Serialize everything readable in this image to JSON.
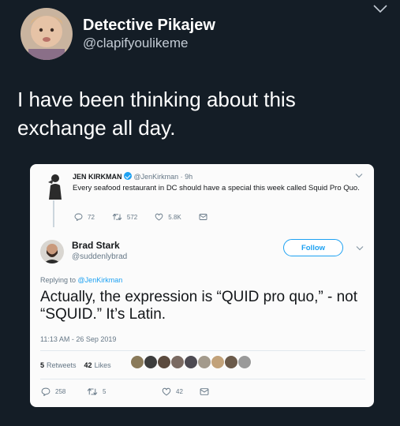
{
  "post": {
    "display_name": "Detective Pikajew",
    "handle": "@clapifyoulikeme",
    "text": "I have been thinking about this exchange all day."
  },
  "quoted_tweet": {
    "name": "JEN KIRKMAN",
    "handle": "@JenKirkman · 9h",
    "text": "Every seafood restaurant in DC should have a special this week called Squid Pro Quo.",
    "replies": "72",
    "retweets": "572",
    "likes": "5.8K"
  },
  "reply_tweet": {
    "name": "Brad Stark",
    "handle": "@suddenlybrad",
    "follow_label": "Follow",
    "replying_to_label": "Replying to",
    "replying_to_handle": "@JenKirkman",
    "text": "Actually, the expression is “QUID pro quo,” - not “SQUID.” It’s Latin.",
    "timestamp": "11:13 AM - 26 Sep 2019",
    "retweets_count": "5",
    "retweets_label": "Retweets",
    "likes_count": "42",
    "likes_label": "Likes",
    "action_replies": "258",
    "action_retweets": "5",
    "action_likes": "42"
  },
  "colors": {
    "background": "#141d26",
    "accent": "#1da1f2",
    "card": "#fbfbfb",
    "muted": "#657786"
  },
  "icons": {
    "top_caret": "chevron-down-icon",
    "reply": "reply-icon",
    "retweet": "retweet-icon",
    "like": "heart-icon",
    "message": "message-icon",
    "verified": "verified-badge-icon"
  }
}
